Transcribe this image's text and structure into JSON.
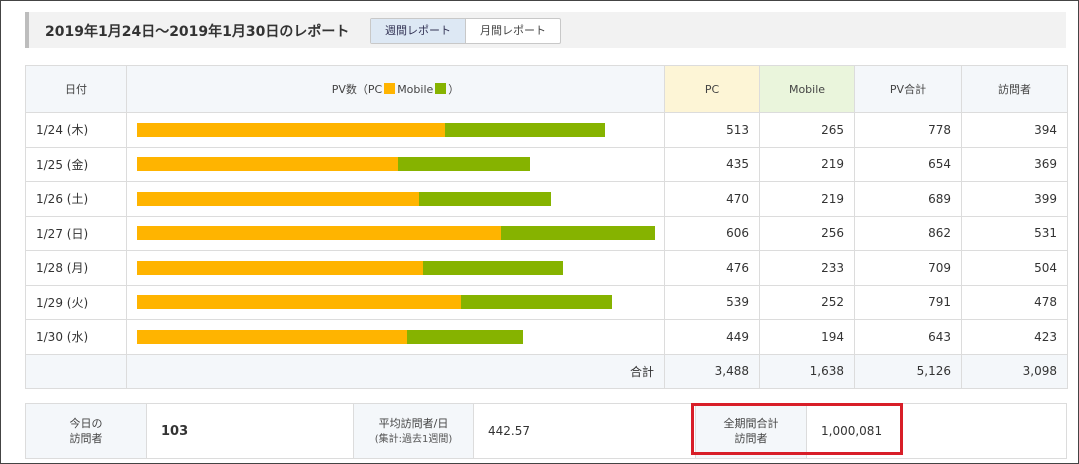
{
  "header": {
    "title": "2019年1月24日〜2019年1月30日のレポート",
    "tabs": [
      {
        "label": "週間レポート",
        "active": true
      },
      {
        "label": "月間レポート",
        "active": false
      }
    ]
  },
  "table": {
    "columns": {
      "date": "日付",
      "pv_prefix": "PV数（PC",
      "pv_mid": "Mobile",
      "pv_suffix": "）",
      "pc": "PC",
      "mobile": "Mobile",
      "pv_total": "PV合計",
      "visitors": "訪問者"
    },
    "rows": [
      {
        "date": "1/24 (木)",
        "pc": "513",
        "mobile": "265",
        "total": "778",
        "visitors": "394"
      },
      {
        "date": "1/25 (金)",
        "pc": "435",
        "mobile": "219",
        "total": "654",
        "visitors": "369"
      },
      {
        "date": "1/26 (土)",
        "pc": "470",
        "mobile": "219",
        "total": "689",
        "visitors": "399"
      },
      {
        "date": "1/27 (日)",
        "pc": "606",
        "mobile": "256",
        "total": "862",
        "visitors": "531"
      },
      {
        "date": "1/28 (月)",
        "pc": "476",
        "mobile": "233",
        "total": "709",
        "visitors": "504"
      },
      {
        "date": "1/29 (火)",
        "pc": "539",
        "mobile": "252",
        "total": "791",
        "visitors": "478"
      },
      {
        "date": "1/30 (水)",
        "pc": "449",
        "mobile": "194",
        "total": "643",
        "visitors": "423"
      }
    ],
    "totals": {
      "label": "合計",
      "pc": "3,488",
      "mobile": "1,638",
      "total": "5,126",
      "visitors": "3,098"
    }
  },
  "colors": {
    "pc": "#ffb400",
    "mobile": "#86b300",
    "highlight": "#d81e28"
  },
  "summary": {
    "today_label_1": "今日の",
    "today_label_2": "訪問者",
    "today_value": "103",
    "avg_label_1": "平均訪問者/日",
    "avg_label_2": "(集計:過去1週間)",
    "avg_value": "442.57",
    "all_label_1": "全期間合計",
    "all_label_2": "訪問者",
    "all_value": "1,000,081"
  }
}
